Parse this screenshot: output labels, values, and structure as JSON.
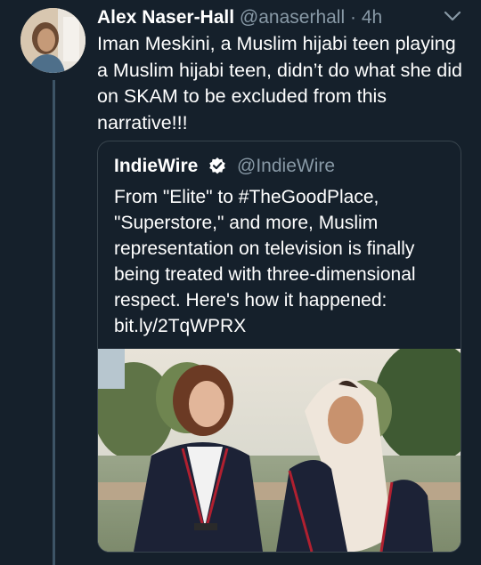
{
  "tweet": {
    "author_name": "Alex Naser-Hall",
    "handle": "@anaserhall",
    "separator": "·",
    "time": "4h",
    "text": "Iman Meskini, a Muslim hijabi teen playing a Muslim hijabi teen, didn’t do what she did on SKAM to be excluded from this narrative!!!"
  },
  "quoted_tweet": {
    "author_name": "IndieWire",
    "handle": "@IndieWire",
    "text_lines": [
      "From \"Elite\" to #TheGoodPlace,",
      "\"Superstore,\" and more, Muslim",
      "representation on television is finally",
      "being treated with three-dimensional",
      "respect. Here's how it happened:",
      "bit.ly/2TqWPRX"
    ]
  },
  "icons": {
    "caret": "chevron-down-icon",
    "verified": "verified-badge-icon"
  },
  "colors": {
    "background": "#15202b",
    "secondary_text": "#8899a6",
    "border": "#38444d",
    "verified": "#ffffff"
  }
}
